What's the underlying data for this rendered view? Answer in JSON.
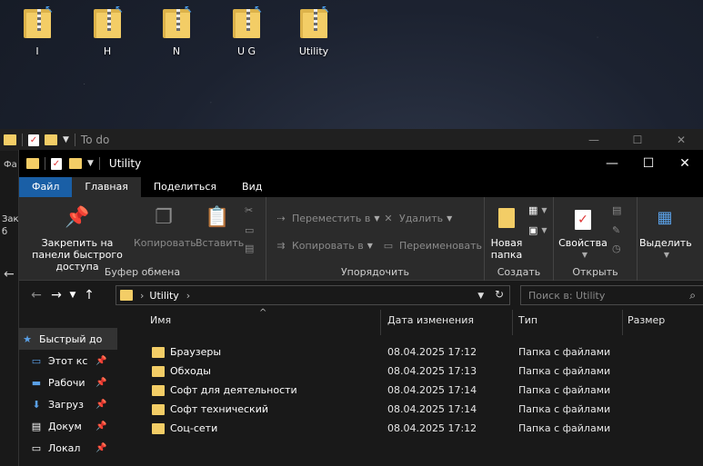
{
  "desktop": {
    "icons": [
      "I",
      "H",
      "N",
      "U G",
      "Utility"
    ]
  },
  "back_window": {
    "title": "To do",
    "side_text_1": "Закр",
    "side_text_2": "б",
    "side_text_3": "Фа"
  },
  "window": {
    "title": "Utility",
    "controls": {
      "minimize": "—",
      "maximize": "☐",
      "close": "✕"
    }
  },
  "tabs": [
    "Файл",
    "Главная",
    "Поделиться",
    "Вид"
  ],
  "ribbon": {
    "clipboard": {
      "group": "Буфер обмена",
      "pin": "Закрепить на панели быстрого доступа",
      "copy": "Копировать",
      "paste": "Вставить"
    },
    "organize": {
      "group": "Упорядочить",
      "move": "Переместить в",
      "copy_to": "Копировать в",
      "delete": "Удалить",
      "rename": "Переименовать"
    },
    "create": {
      "group": "Создать",
      "new_folder": "Новая папка"
    },
    "open": {
      "group": "Открыть",
      "properties": "Свойства"
    },
    "select": {
      "label": "Выделить"
    }
  },
  "address": {
    "crumb": "Utility",
    "search_placeholder": "Поиск в: Utility"
  },
  "nav_pane": {
    "items": [
      {
        "label": "Быстрый до",
        "icon": "star-icon"
      },
      {
        "label": "Этот кс",
        "icon": "monitor-icon"
      },
      {
        "label": "Рабочи",
        "icon": "desktop-icon"
      },
      {
        "label": "Загруз",
        "icon": "download-icon"
      },
      {
        "label": "Докум",
        "icon": "document-icon"
      },
      {
        "label": "Локал",
        "icon": "drive-icon"
      }
    ]
  },
  "columns": {
    "name": "Имя",
    "date": "Дата изменения",
    "type": "Тип",
    "size": "Размер"
  },
  "files": [
    {
      "name": "Браузеры",
      "date": "08.04.2025 17:12",
      "type": "Папка с файлами"
    },
    {
      "name": "Обходы",
      "date": "08.04.2025 17:13",
      "type": "Папка с файлами"
    },
    {
      "name": "Софт для деятельности",
      "date": "08.04.2025 17:14",
      "type": "Папка с файлами"
    },
    {
      "name": "Софт технический",
      "date": "08.04.2025 17:14",
      "type": "Папка с файлами"
    },
    {
      "name": "Соц-сети",
      "date": "08.04.2025 17:12",
      "type": "Папка с файлами"
    }
  ],
  "colors": {
    "file_tab": "#1a5fa6",
    "folder": "#f3cd66",
    "ribbon_bg": "#2b2b2b",
    "window_bg": "#191919"
  }
}
